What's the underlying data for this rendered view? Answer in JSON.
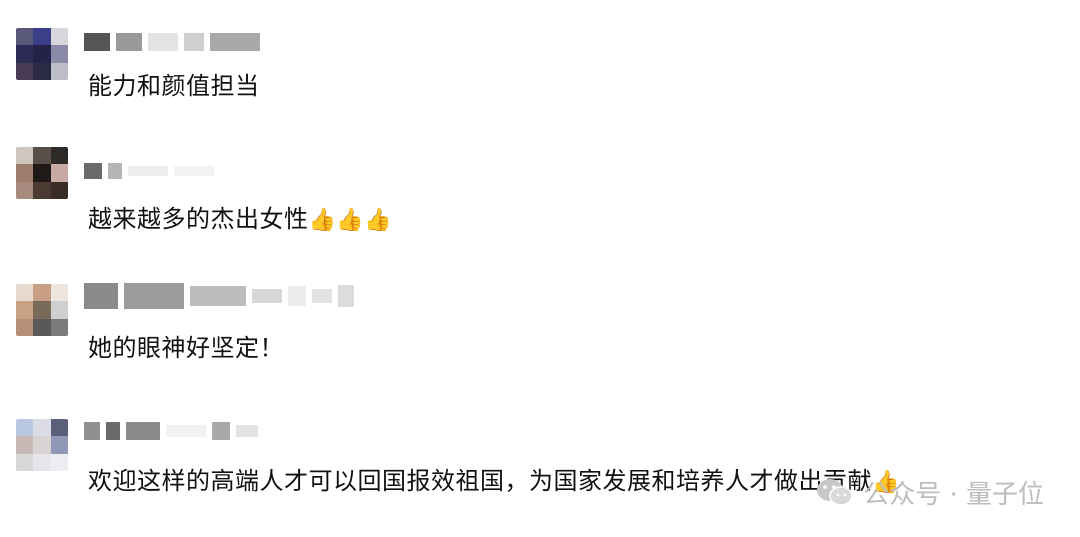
{
  "comments": [
    {
      "text": "能力和颜值担当",
      "emojis": ""
    },
    {
      "text": "越来越多的杰出女性",
      "emojis": "👍👍👍"
    },
    {
      "text": "她的眼神好坚定！",
      "emojis": ""
    },
    {
      "text": "欢迎这样的高端人才可以回国报效祖国，为国家发展和培养人才做出贡献",
      "emojis": "👍"
    }
  ],
  "watermark": {
    "label": "公众号 · 量子位"
  },
  "icons": {
    "wechat": "wechat-icon"
  }
}
